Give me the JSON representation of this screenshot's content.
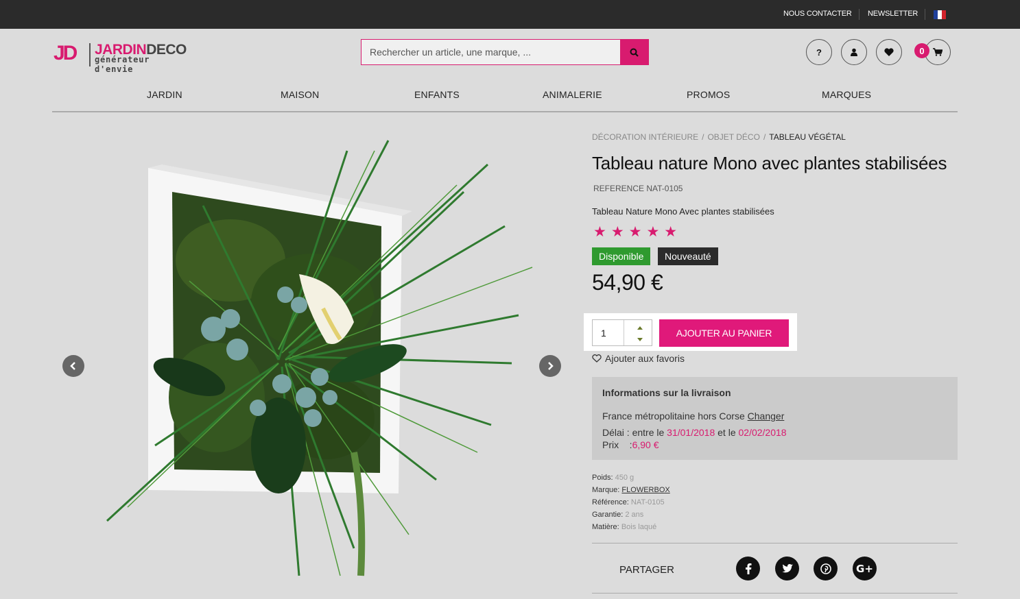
{
  "topbar": {
    "contact": "NOUS CONTACTER",
    "newsletter": "NEWSLETTER",
    "language_icon": "france-flag-icon"
  },
  "brand": {
    "initials": "JD",
    "name_part1": "JARDIN",
    "name_part2": "DECO",
    "tagline": "générateur d'envie",
    "accent_color": "#d81b6f"
  },
  "search": {
    "placeholder": "Rechercher un article, une marque, ...",
    "button_icon": "search-icon"
  },
  "header_icons": {
    "help": "?",
    "cart_count": "0"
  },
  "nav": {
    "items": [
      "JARDIN",
      "MAISON",
      "ENFANTS",
      "ANIMALERIE",
      "PROMOS",
      "MARQUES"
    ]
  },
  "breadcrumb": {
    "items": [
      "DÉCORATION INTÉRIEURE",
      "OBJET DÉCO",
      "TABLEAU VÉGÉTAL"
    ],
    "separator": "/"
  },
  "product": {
    "title": "Tableau nature Mono avec plantes stabilisées",
    "reference": "REFERENCE NAT-0105",
    "description": "Tableau Nature Mono Avec plantes stabilisées",
    "rating_stars": 5,
    "stars_text": "★★★★★",
    "badge_available": "Disponible",
    "badge_new": "Nouveauté",
    "badge_available_color": "#2f9a2f",
    "badge_new_color": "#2b2b2b",
    "price": "54,90 €",
    "quantity": "1",
    "add_to_cart": "AJOUTER AU PANIER",
    "add_to_favorites": "Ajouter aux favoris"
  },
  "shipping": {
    "heading": "Informations sur la livraison",
    "zone": "France métropolitaine hors Corse",
    "change_link": "Changer",
    "delay_label": "Délai : entre le",
    "date_from": "31/01/2018",
    "date_and": "et le",
    "date_to": "02/02/2018",
    "price_label": "Prix    :",
    "price_value": "6,90 €"
  },
  "specs": [
    {
      "label": "Poids:",
      "value": "450 g"
    },
    {
      "label": "Marque:",
      "value": "FLOWERBOX"
    },
    {
      "label": "Référence:",
      "value": "NAT-0105"
    },
    {
      "label": "Garantie:",
      "value": "2 ans"
    },
    {
      "label": "Matière:",
      "value": "Bois laqué"
    }
  ],
  "share": {
    "label": "PARTAGER",
    "networks": [
      "facebook",
      "twitter",
      "pinterest",
      "google-plus"
    ]
  }
}
